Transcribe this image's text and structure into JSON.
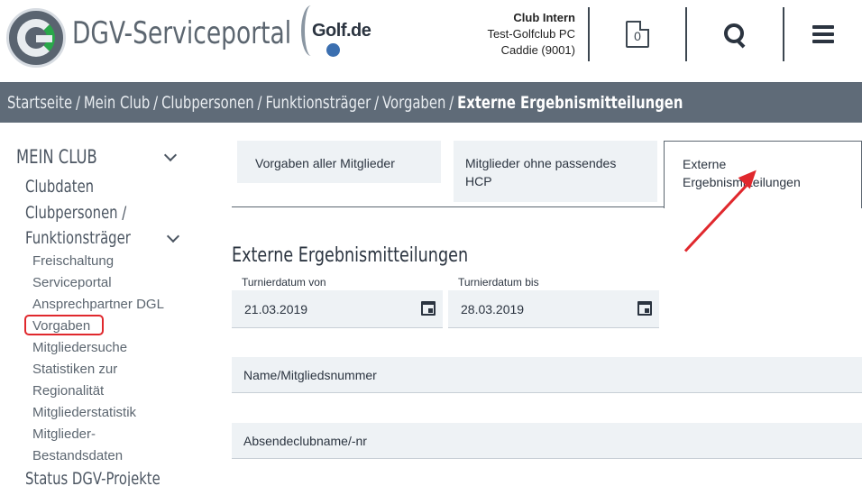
{
  "header": {
    "site_title": "DGV-Serviceportal",
    "logo_ring_text": "DEUTSCHER GOLF VERBAND",
    "partner_logo": "Golf.de",
    "club_info": {
      "title": "Club Intern",
      "club_name": "Test-Golfclub PC",
      "role": "Caddie (9001)"
    },
    "notification_count": "0",
    "icons": [
      "document-icon",
      "search-icon",
      "menu-icon"
    ]
  },
  "breadcrumb": {
    "items": [
      "Startseite",
      "Mein Club",
      "Clubpersonen",
      "Funktionsträger",
      "Vorgaben"
    ],
    "current": "Externe Ergebnismitteilungen",
    "separator": "/"
  },
  "sidebar": {
    "section": "MEIN CLUB",
    "items": [
      {
        "label": "Clubdaten"
      },
      {
        "label_line1": "Clubpersonen /",
        "label_line2": "Funktionsträger"
      }
    ],
    "subitems": [
      "Freischaltung",
      "Serviceportal",
      "Ansprechpartner DGL",
      "Vorgaben",
      "Mitgliedersuche",
      "Statistiken zur",
      "Regionalität",
      "Mitgliederstatistik",
      "Mitglieder-",
      "Bestandsdaten"
    ],
    "next_section": "Status DGV-Projekte",
    "active_item": "Vorgaben"
  },
  "tabs": [
    {
      "label": "Vorgaben aller Mitglieder"
    },
    {
      "label_line1": "Mitglieder ohne passendes",
      "label_line2": "HCP"
    },
    {
      "label": "Externe Ergebnismitteilungen",
      "active": true
    }
  ],
  "form": {
    "title": "Externe Ergebnismitteilungen",
    "date_from": {
      "label": "Turnierdatum von",
      "value": "21.03.2019"
    },
    "date_to": {
      "label": "Turnierdatum bis",
      "value": "28.03.2019"
    },
    "member_field": {
      "placeholder": "Name/Mitgliedsnummer"
    },
    "club_field": {
      "placeholder": "Absendeclubname/-nr"
    }
  },
  "colors": {
    "breadcrumb_bg": "#5f6b78",
    "field_bg": "#eef2f5",
    "highlight": "#e0282d",
    "brand_green": "#2aa74a"
  }
}
